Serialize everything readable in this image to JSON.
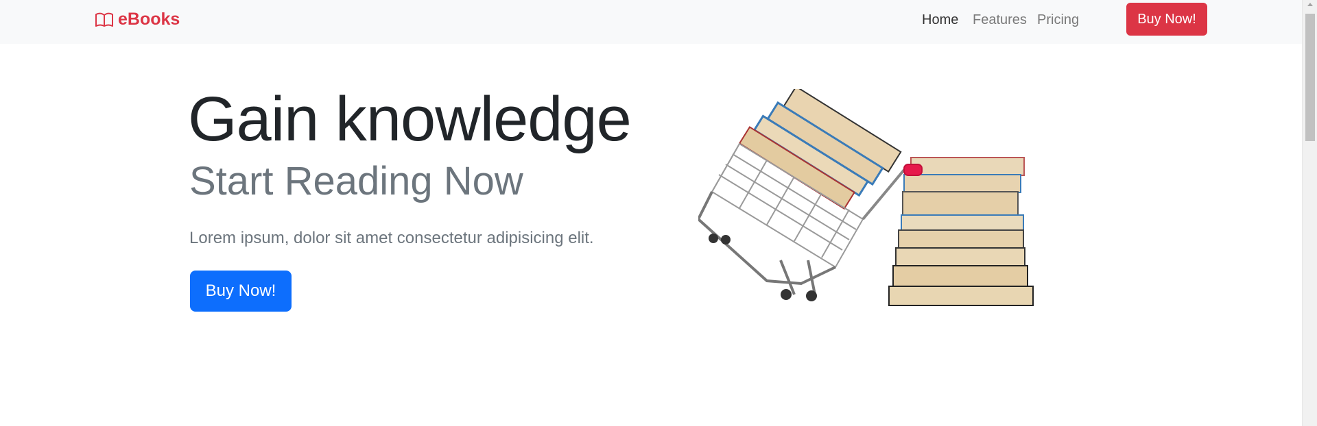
{
  "navbar": {
    "brand": "eBooks",
    "links": [
      "Home",
      "Features",
      "Pricing"
    ],
    "button": "Buy Now!"
  },
  "hero": {
    "title": "Gain knowledge",
    "subtitle": "Start Reading Now",
    "lead": "Lorem ipsum, dolor sit amet consectetur adipisicing elit.",
    "button": "Buy Now!"
  },
  "colors": {
    "brand": "#dc3545",
    "primary": "#0d6efd",
    "navbar_bg": "#f8f9fa",
    "muted": "#6c757d"
  },
  "icons": {
    "brand_icon": "book-icon"
  }
}
